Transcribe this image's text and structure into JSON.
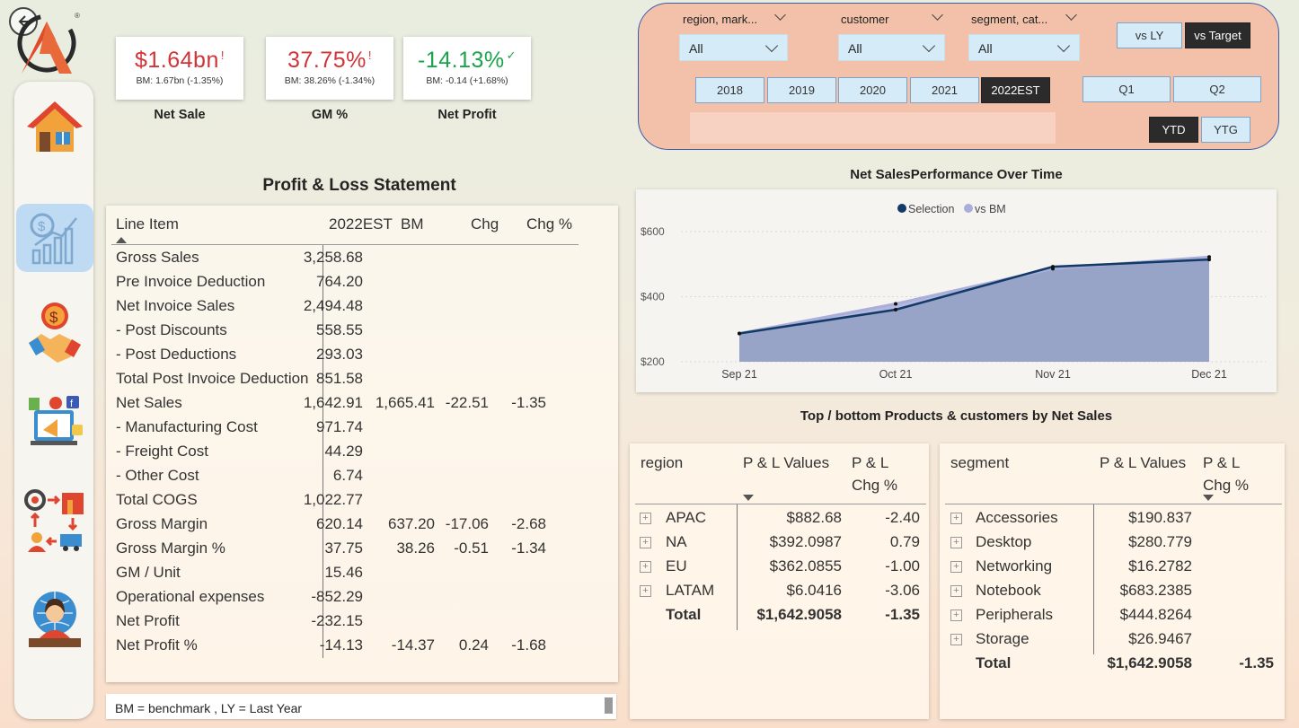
{
  "kpis": [
    {
      "value": "$1.64bn",
      "flag": "!",
      "bm": "BM: 1.67bn (-1.35%)",
      "label": "Net Sale",
      "color": "#d13438"
    },
    {
      "value": "37.75%",
      "flag": "!",
      "bm": "BM: 38.26% (-1.34%)",
      "label": "GM %",
      "color": "#d13438"
    },
    {
      "value": "-14.13%",
      "flag": "✓",
      "bm": "BM: -0.14 (+1.68%)",
      "label": "Net Profit",
      "color": "#1aa44b"
    }
  ],
  "nav": {
    "icons": [
      "home-icon",
      "finance-chart-icon",
      "handshake-icon",
      "marketing-icon",
      "supply-chain-icon",
      "executive-icon"
    ]
  },
  "pl": {
    "title": "Profit & Loss Statement",
    "headers": [
      "Line Item",
      "2022EST",
      "BM",
      "Chg",
      "Chg %"
    ],
    "rows": [
      {
        "name": "Gross Sales",
        "v": "3,258.68",
        "bm": "",
        "chg": "",
        "pct": ""
      },
      {
        "name": "Pre Invoice Deduction",
        "v": "764.20",
        "bm": "",
        "chg": "",
        "pct": ""
      },
      {
        "name": "Net Invoice Sales",
        "v": "2,494.48",
        "bm": "",
        "chg": "",
        "pct": ""
      },
      {
        "name": " - Post Discounts",
        "v": "558.55",
        "bm": "",
        "chg": "",
        "pct": ""
      },
      {
        "name": " - Post Deductions",
        "v": "293.03",
        "bm": "",
        "chg": "",
        "pct": ""
      },
      {
        "name": "Total Post Invoice Deduction",
        "v": "851.58",
        "bm": "",
        "chg": "",
        "pct": ""
      },
      {
        "name": "Net Sales",
        "v": "1,642.91",
        "bm": "1,665.41",
        "chg": "-22.51",
        "pct": "-1.35"
      },
      {
        "name": " - Manufacturing Cost",
        "v": "971.74",
        "bm": "",
        "chg": "",
        "pct": ""
      },
      {
        "name": " - Freight Cost",
        "v": "44.29",
        "bm": "",
        "chg": "",
        "pct": ""
      },
      {
        "name": " - Other Cost",
        "v": "6.74",
        "bm": "",
        "chg": "",
        "pct": ""
      },
      {
        "name": "Total COGS",
        "v": "1,022.77",
        "bm": "",
        "chg": "",
        "pct": ""
      },
      {
        "name": "Gross Margin",
        "v": "620.14",
        "bm": "637.20",
        "chg": "-17.06",
        "pct": "-2.68"
      },
      {
        "name": "Gross Margin %",
        "v": "37.75",
        "bm": "38.26",
        "chg": "-0.51",
        "pct": "-1.34"
      },
      {
        "name": "GM / Unit",
        "v": "15.46",
        "bm": "",
        "chg": "",
        "pct": ""
      },
      {
        "name": "Operational expenses",
        "v": "-852.29",
        "bm": "",
        "chg": "",
        "pct": ""
      },
      {
        "name": "Net Profit",
        "v": "-232.15",
        "bm": "",
        "chg": "",
        "pct": ""
      },
      {
        "name": "Net Profit %",
        "v": "-14.13",
        "bm": "-14.37",
        "chg": "0.24",
        "pct": "-1.68"
      }
    ],
    "note": "BM = benchmark , LY = Last Year"
  },
  "filters": {
    "slicers": [
      {
        "title": "region, mark...",
        "value": "All"
      },
      {
        "title": "customer",
        "value": "All"
      },
      {
        "title": "segment, cat...",
        "value": "All"
      }
    ],
    "compare": [
      {
        "label": "vs LY",
        "selected": false
      },
      {
        "label": "vs Target",
        "selected": true
      }
    ],
    "years": [
      {
        "label": "2018",
        "selected": false
      },
      {
        "label": "2019",
        "selected": false
      },
      {
        "label": "2020",
        "selected": false
      },
      {
        "label": "2021",
        "selected": false
      },
      {
        "label": "2022EST",
        "selected": true
      }
    ],
    "quarters": [
      {
        "label": "Q1",
        "selected": false
      },
      {
        "label": "Q2",
        "selected": false
      }
    ],
    "period": [
      {
        "label": "YTD",
        "selected": true
      },
      {
        "label": "YTG",
        "selected": false
      }
    ]
  },
  "chart_data": {
    "type": "area",
    "title": "Net SalesPerformance Over Time",
    "categories": [
      "Sep 21",
      "Oct 21",
      "Nov 21",
      "Dec 21"
    ],
    "series": [
      {
        "name": "Selection",
        "values": [
          287,
          360,
          492,
          514
        ],
        "color": "#123a66"
      },
      {
        "name": "vs BM",
        "values": [
          287,
          378,
          486,
          522
        ],
        "color": "#a9aedb"
      }
    ],
    "ylim": [
      200,
      600
    ],
    "yticks": [
      "$200",
      "$400",
      "$600"
    ],
    "ytick_values": [
      200,
      400,
      600
    ],
    "legend": "top-center",
    "grid": true
  },
  "top_bottom": {
    "title": "Top / bottom Products & customers by Net Sales",
    "region": {
      "headers": [
        "region",
        "P & L Values",
        "P & L",
        "Chg %"
      ],
      "rows": [
        {
          "name": "APAC",
          "v": "$882.68",
          "chg": "-2.40"
        },
        {
          "name": "NA",
          "v": "$392.0987",
          "chg": "0.79"
        },
        {
          "name": "EU",
          "v": "$362.0855",
          "chg": "-1.00"
        },
        {
          "name": "LATAM",
          "v": "$6.0416",
          "chg": "-3.06"
        }
      ],
      "total": {
        "name": "Total",
        "v": "$1,642.9058",
        "chg": "-1.35"
      }
    },
    "segment": {
      "headers": [
        "segment",
        "P & L Values",
        "P & L",
        "Chg %"
      ],
      "rows": [
        {
          "name": "Accessories",
          "v": "$190.837",
          "chg": ""
        },
        {
          "name": "Desktop",
          "v": "$280.779",
          "chg": ""
        },
        {
          "name": "Networking",
          "v": "$16.2782",
          "chg": ""
        },
        {
          "name": "Notebook",
          "v": "$683.2385",
          "chg": ""
        },
        {
          "name": "Peripherals",
          "v": "$444.8264",
          "chg": ""
        },
        {
          "name": "Storage",
          "v": "$26.9467",
          "chg": ""
        }
      ],
      "total": {
        "name": "Total",
        "v": "$1,642.9058",
        "chg": "-1.35"
      }
    }
  }
}
